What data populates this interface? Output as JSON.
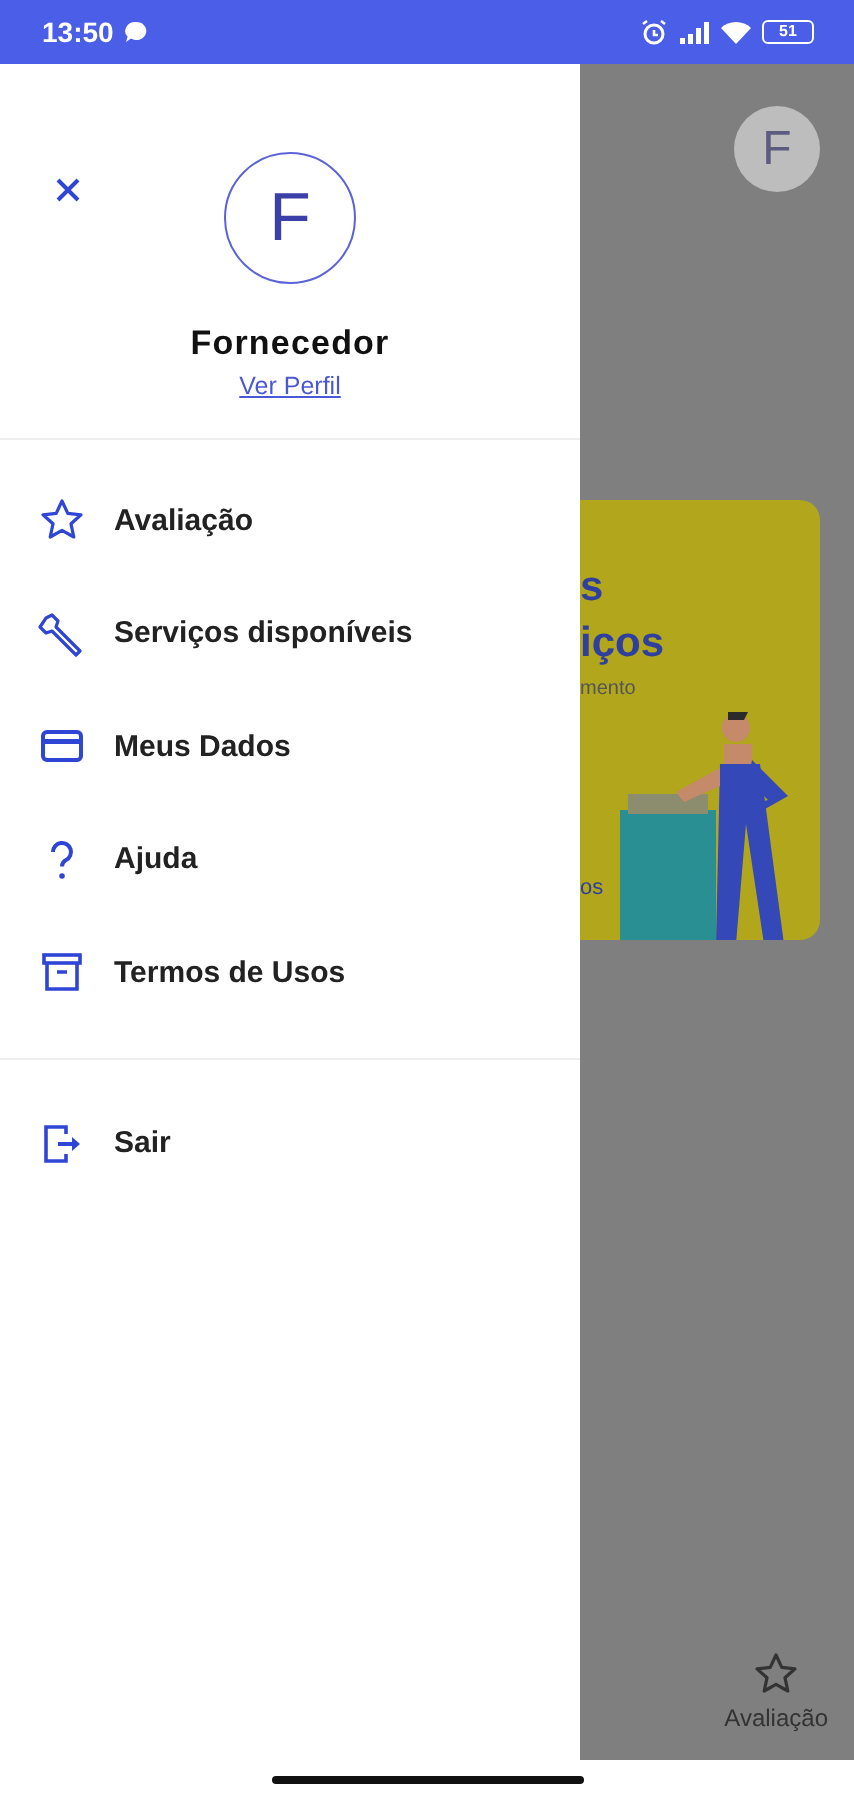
{
  "status_bar": {
    "time": "13:50",
    "battery": "51"
  },
  "drawer": {
    "avatar_letter": "F",
    "name": "Fornecedor",
    "profile_link": "Ver Perfil",
    "menu": [
      {
        "kind": "star",
        "label": "Avaliação"
      },
      {
        "kind": "wrench",
        "label": "Serviços disponíveis"
      },
      {
        "kind": "card",
        "label": "Meus Dados"
      },
      {
        "kind": "help",
        "label": "Ajuda"
      },
      {
        "kind": "archive",
        "label": "Termos de Usos"
      }
    ],
    "footer_menu": [
      {
        "kind": "logout",
        "label": "Sair"
      }
    ]
  },
  "background": {
    "avatar_letter": "F",
    "banner": {
      "title_lines": [
        "s",
        "iços"
      ],
      "subtitle": "mento",
      "footer": "os"
    },
    "bottom_nav": [
      {
        "kind": "star",
        "label": "Avaliação"
      }
    ]
  }
}
